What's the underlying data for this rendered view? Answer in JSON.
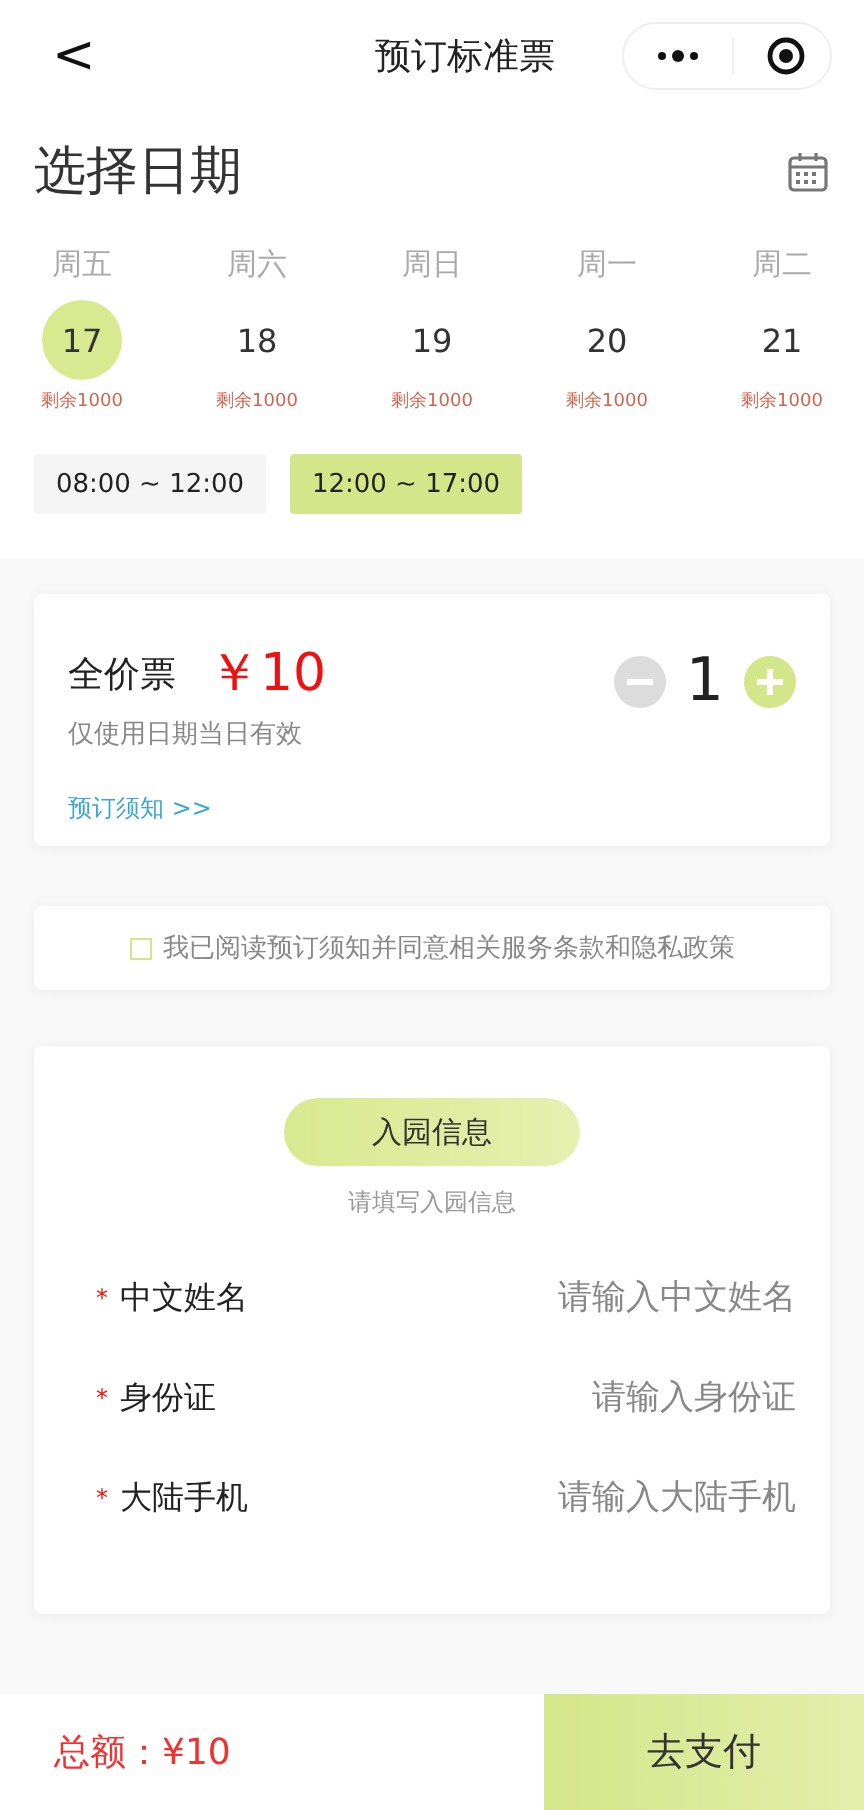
{
  "nav_bar": {
    "back": "<",
    "title": "预订标准票"
  },
  "date_picker": {
    "title": "选择日期",
    "days": [
      {
        "weekday": "周五",
        "date": "17",
        "remaining": "剩余1000",
        "selected": true
      },
      {
        "weekday": "周六",
        "date": "18",
        "remaining": "剩余1000",
        "selected": false
      },
      {
        "weekday": "周日",
        "date": "19",
        "remaining": "剩余1000",
        "selected": false
      },
      {
        "weekday": "周一",
        "date": "20",
        "remaining": "剩余1000",
        "selected": false
      },
      {
        "weekday": "周二",
        "date": "21",
        "remaining": "剩余1000",
        "selected": false
      }
    ],
    "time_slots": [
      {
        "label": "08:00 ~ 12:00",
        "selected": false
      },
      {
        "label": "12:00 ~ 17:00",
        "selected": true
      }
    ]
  },
  "ticket": {
    "name": "全价票",
    "price": "￥10",
    "note": "仅使用日期当日有效",
    "link": "预订须知 >>",
    "quantity": "1"
  },
  "agreement": {
    "text": "我已阅读预订须知并同意相关服务条款和隐私政策",
    "checked": false
  },
  "visitor_info": {
    "title": "入园信息",
    "subtitle": "请填写入园信息",
    "fields": [
      {
        "required_mark": "*",
        "label": "中文姓名",
        "placeholder": "请输入中文姓名"
      },
      {
        "required_mark": "*",
        "label": "身份证",
        "placeholder": "请输入身份证"
      },
      {
        "required_mark": "*",
        "label": "大陆手机",
        "placeholder": "请输入大陆手机"
      }
    ]
  },
  "footer": {
    "total": "总额：¥10",
    "pay_button": "去支付"
  }
}
